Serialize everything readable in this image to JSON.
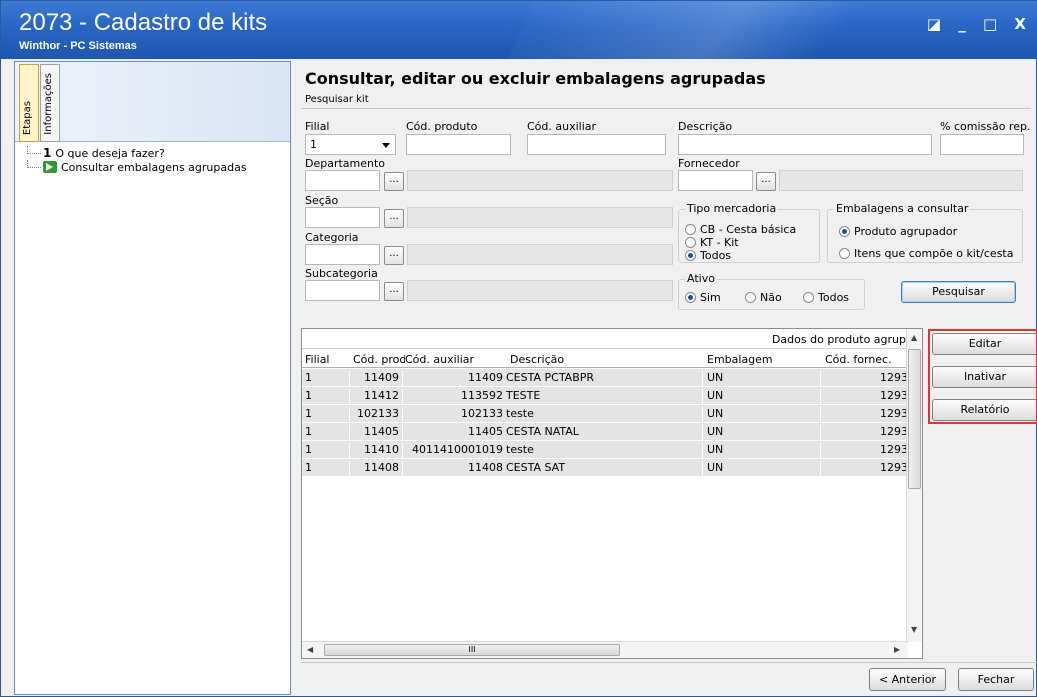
{
  "window": {
    "title": "2073 - Cadastro de kits",
    "subtitle": "Winthor - PC Sistemas",
    "controls": [
      "◪",
      "_",
      "□",
      "X"
    ]
  },
  "sidebar": {
    "tabs": [
      "Etapas",
      "Informações"
    ],
    "steps": [
      {
        "number": "1",
        "label": "O que deseja fazer?"
      },
      {
        "number": "",
        "label": "Consultar embalagens agrupadas"
      }
    ]
  },
  "header": {
    "title": "Consultar, editar ou excluir embalagens agrupadas",
    "subtitle": "Pesquisar kit"
  },
  "form": {
    "filial_label": "Filial",
    "filial_value": "1",
    "cod_produto_label": "Cód. produto",
    "cod_auxiliar_label": "Cód. auxiliar",
    "descricao_label": "Descrição",
    "comissao_label": "% comissão rep.",
    "departamento_label": "Departamento",
    "fornecedor_label": "Fornecedor",
    "secao_label": "Seção",
    "categoria_label": "Categoria",
    "subcategoria_label": "Subcategoria",
    "ellipsis": "..."
  },
  "tipo_mercadoria": {
    "title": "Tipo mercadoria",
    "options": [
      "CB - Cesta básica",
      "KT - Kit",
      "Todos"
    ],
    "selected": "Todos"
  },
  "embalagens": {
    "title": "Embalagens a consultar",
    "options": [
      "Produto agrupador",
      "Itens que compõe o kit/cesta"
    ],
    "selected": "Produto agrupador"
  },
  "ativo": {
    "title": "Ativo",
    "options": [
      "Sim",
      "Não",
      "Todos"
    ],
    "selected": "Sim"
  },
  "buttons": {
    "pesquisar": "Pesquisar",
    "editar": "Editar",
    "inativar": "Inativar",
    "relatorio": "Relatório",
    "anterior": "< Anterior",
    "fechar": "Fechar"
  },
  "grid": {
    "band_label": "Dados do produto agrup",
    "columns": [
      "Filial",
      "Cód. produ",
      "Cód. auxiliar",
      "Descrição",
      "Embalagem",
      "Cód. fornec."
    ],
    "rows": [
      [
        "1",
        "11409",
        "11409",
        "CESTA PCTABPR",
        "UN",
        "1293"
      ],
      [
        "1",
        "11412",
        "113592",
        "TESTE",
        "UN",
        "1293"
      ],
      [
        "1",
        "102133",
        "102133",
        "teste",
        "UN",
        "1293"
      ],
      [
        "1",
        "11405",
        "11405",
        "CESTA NATAL",
        "UN",
        "1293"
      ],
      [
        "1",
        "11410",
        "4011410001019",
        "teste",
        "UN",
        "1293"
      ],
      [
        "1",
        "11408",
        "11408",
        "CESTA SAT",
        "UN",
        "1293"
      ]
    ],
    "scroll_thumb_grip": "III"
  }
}
